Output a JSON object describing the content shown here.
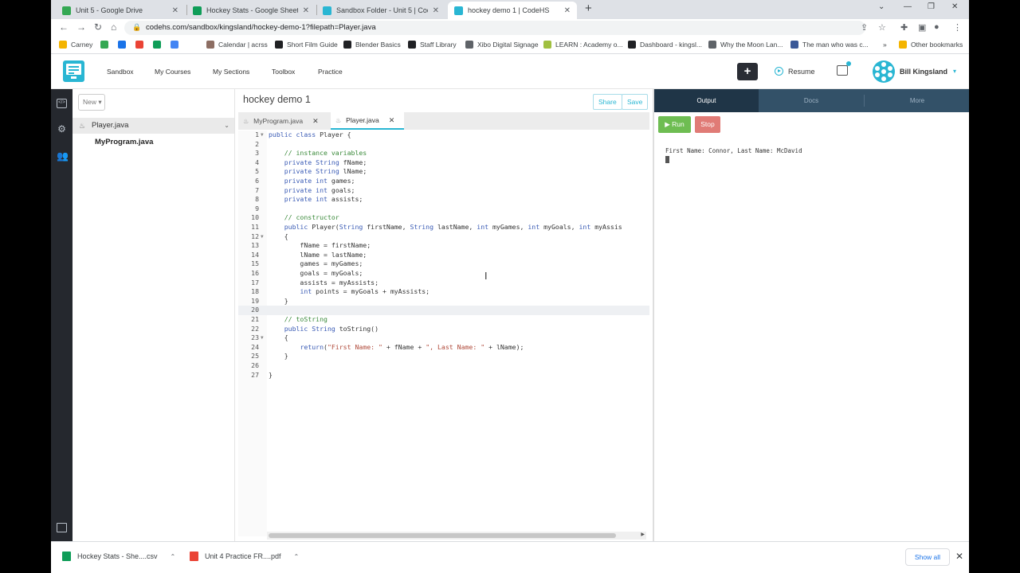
{
  "browser": {
    "tabs": [
      {
        "title": "Unit 5 - Google Drive",
        "color": "#34a853"
      },
      {
        "title": "Hockey Stats - Google Sheets",
        "color": "#0f9d58"
      },
      {
        "title": "Sandbox Folder - Unit 5 | CodeHS",
        "color": "#29b6d3"
      },
      {
        "title": "hockey demo 1 | CodeHS",
        "color": "#29b6d3"
      }
    ],
    "new_tab": "+",
    "url": "codehs.com/sandbox/kingsland/hockey-demo-1?filepath=Player.java",
    "bookmarks": [
      {
        "label": "Carney",
        "color": "#f4b400"
      },
      {
        "label": "",
        "color": "#34a853"
      },
      {
        "label": "",
        "color": "#1a73e8"
      },
      {
        "label": "",
        "color": "#ea4335"
      },
      {
        "label": "",
        "color": "#0f9d58"
      },
      {
        "label": "",
        "color": "#4285f4"
      },
      {
        "label": "Calendar | acrss",
        "color": "#8d6e63"
      },
      {
        "label": "Short Film Guide",
        "color": "#202124"
      },
      {
        "label": "Blender Basics",
        "color": "#202124"
      },
      {
        "label": "Staff Library",
        "color": "#202124"
      },
      {
        "label": "Xibo Digital Signage",
        "color": "#5f6368"
      },
      {
        "label": "LEARN : Academy o...",
        "color": "#a0c040"
      },
      {
        "label": "Dashboard - kingsl...",
        "color": "#202124"
      },
      {
        "label": "Why the Moon Lan...",
        "color": "#5f6368"
      },
      {
        "label": "The man who was c...",
        "color": "#3b5998"
      }
    ],
    "bookmarks_overflow": "»",
    "other_bookmarks": "Other bookmarks"
  },
  "codehs": {
    "nav": [
      "Sandbox",
      "My Courses",
      "My Sections",
      "Toolbox",
      "Practice"
    ],
    "plus": "+",
    "resume": "Resume",
    "user": "Bill Kingsland",
    "accent": "#29b6d3"
  },
  "files": {
    "new_label": "New ▾",
    "items": [
      {
        "name": "Player.java",
        "selected": true
      },
      {
        "name": "MyProgram.java",
        "selected": false
      }
    ]
  },
  "editor": {
    "title": "hockey demo 1",
    "share": "Share",
    "save": "Save",
    "tabs": [
      "MyProgram.java",
      "Player.java"
    ],
    "active_tab": 1,
    "current_line": 20,
    "lines": [
      "public class Player {",
      "",
      "    // instance variables",
      "    private String fName;",
      "    private String lName;",
      "    private int games;",
      "    private int goals;",
      "    private int assists;",
      "",
      "    // constructor",
      "    public Player(String firstName, String lastName, int myGames, int myGoals, int myAssis",
      "    {",
      "        fName = firstName;",
      "        lName = lastName;",
      "        games = myGames;",
      "        goals = myGoals;",
      "        assists = myAssists;",
      "        int points = myGoals + myAssists;",
      "    }",
      "",
      "    // toString",
      "    public String toString()",
      "    {",
      "        return(\"First Name: \" + fName + \", Last Name: \" + lName);",
      "    }",
      "",
      "}"
    ],
    "fold_lines": [
      1,
      12,
      23
    ]
  },
  "output": {
    "tabs": [
      "Output",
      "Docs",
      "More"
    ],
    "run": "Run",
    "stop": "Stop",
    "console": "First Name: Connor, Last Name: McDavid"
  },
  "downloads": {
    "items": [
      {
        "name": "Hockey Stats - She....csv",
        "color": "#0f9d58"
      },
      {
        "name": "Unit 4 Practice FR....pdf",
        "color": "#ea4335"
      }
    ],
    "show_all": "Show all"
  }
}
